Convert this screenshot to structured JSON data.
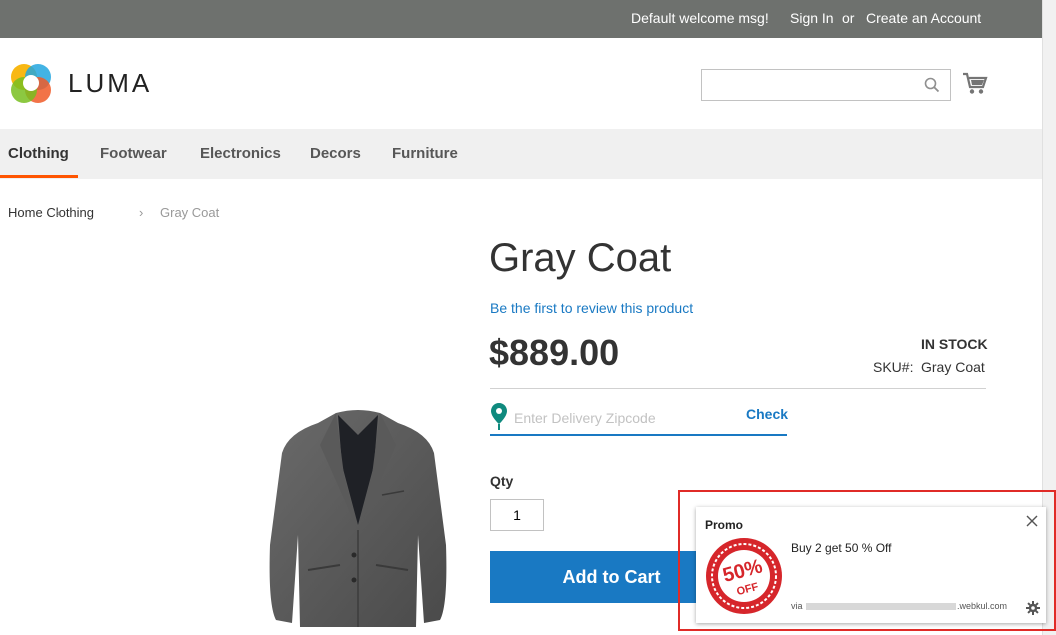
{
  "header": {
    "welcome": "Default welcome msg!",
    "sign_in": "Sign In",
    "or": "or",
    "create_account": "Create an Account"
  },
  "brand": {
    "name": "LUMA",
    "logo_icon": "luma-flower-icon",
    "accent_color": "#ff5501",
    "link_color": "#1979c3"
  },
  "search": {
    "placeholder": "",
    "icon": "search-icon"
  },
  "cart": {
    "icon": "cart-icon"
  },
  "nav": {
    "items": [
      {
        "label": "Clothing",
        "active": true
      },
      {
        "label": "Footwear"
      },
      {
        "label": "Electronics"
      },
      {
        "label": "Decors"
      },
      {
        "label": "Furniture"
      }
    ]
  },
  "breadcrumb": {
    "items": [
      "Home",
      "Clothing",
      "Gray Coat"
    ],
    "separator": "›"
  },
  "product": {
    "title": "Gray Coat",
    "review_link": "Be the first to review this product",
    "price": "$889.00",
    "stock": "IN STOCK",
    "sku_label": "SKU#:",
    "sku_value": "Gray Coat"
  },
  "delivery": {
    "placeholder": "Enter Delivery Zipcode",
    "check_label": "Check",
    "icon": "map-pin-icon"
  },
  "qty": {
    "label": "Qty",
    "value": "1"
  },
  "add_to_cart": "Add to Cart",
  "promo": {
    "title": "Promo",
    "badge_text": "50%",
    "badge_sub": "OFF",
    "message": "Buy 2 get 50 % Off",
    "via_prefix": "via",
    "via_domain": ".webkul.com",
    "badge_color": "#d6262b"
  }
}
